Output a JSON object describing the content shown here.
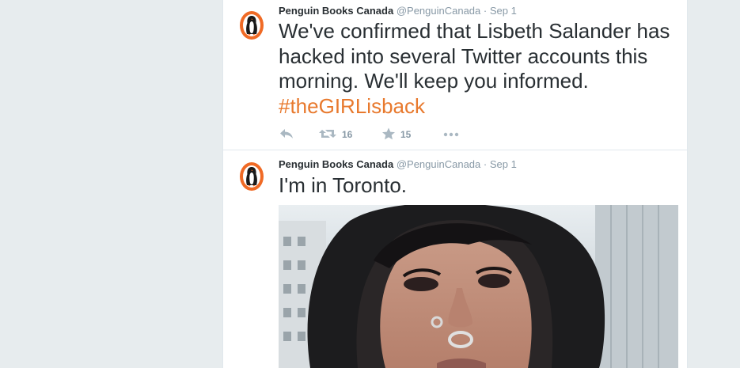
{
  "tweets": [
    {
      "fullname": "Penguin Books Canada",
      "handle": "@PenguinCanada",
      "separator": "·",
      "time": "Sep 1",
      "text": "We've confirmed that Lisbeth Salander has hacked into several Twitter accounts this morning. We'll keep you informed. ",
      "hashtag": "#theGIRLisback",
      "retweets": "16",
      "favorites": "15"
    },
    {
      "fullname": "Penguin Books Canada",
      "handle": "@PenguinCanada",
      "separator": "·",
      "time": "Sep 1",
      "text": "I'm in Toronto."
    }
  ],
  "colors": {
    "page_background": "#e7ecee",
    "brand_orange": "#f06a25",
    "hashtag": "#e8792d",
    "muted": "#8899a6",
    "icon_muted": "#aab8c2",
    "text": "#292f33"
  },
  "icons": [
    "penguin-logo-icon",
    "reply-icon",
    "retweet-icon",
    "favorite-star-icon",
    "more-dots-icon"
  ]
}
